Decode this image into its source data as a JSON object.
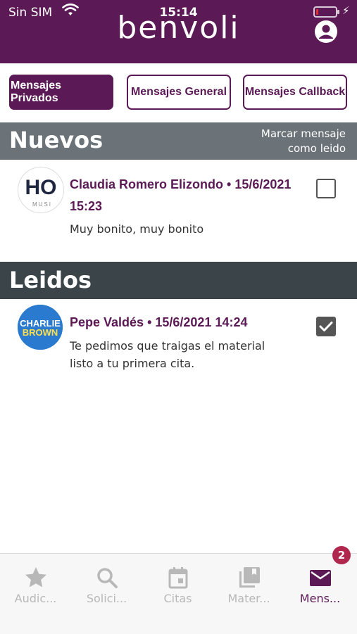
{
  "status_bar": {
    "carrier": "Sin SIM",
    "time": "15:14"
  },
  "header": {
    "logo": "benvoli"
  },
  "tabs": [
    {
      "label": "Mensajes Privados",
      "active": true
    },
    {
      "label": "Mensajes General",
      "active": false
    },
    {
      "label": "Mensajes Callback",
      "active": false
    }
  ],
  "nuevos": {
    "title": "Nuevos",
    "mark_label_line1": "Marcar mensaje",
    "mark_label_line2": "como leido",
    "messages": [
      {
        "sender_line1": "Claudia Romero Elizondo • 15/6/2021",
        "sender_line2": "15:23",
        "body": "Muy bonito, muy bonito",
        "avatar_text": "HO",
        "avatar_sub": "MUSI",
        "read": false
      }
    ]
  },
  "leidos": {
    "title": "Leidos",
    "messages": [
      {
        "sender_line1": "Pepe  Valdés • 15/6/2021 14:24",
        "body_line1": "Te pedimos que traigas el material",
        "body_line2": "listo a tu primera cita.",
        "avatar_text1": "CHARLIE",
        "avatar_text2": "BROWN",
        "read": true
      }
    ]
  },
  "navbar": {
    "items": [
      {
        "label": "Audic...",
        "icon": "star-icon"
      },
      {
        "label": "Solici...",
        "icon": "search-icon"
      },
      {
        "label": "Citas",
        "icon": "calendar-icon"
      },
      {
        "label": "Mater...",
        "icon": "library-icon"
      },
      {
        "label": "Mens...",
        "icon": "mail-icon",
        "active": true
      }
    ],
    "badge": "2"
  },
  "colors": {
    "brand": "#5b1a55",
    "nuevos_bar": "#6b7378",
    "leidos_bar": "#3b4449",
    "badge": "#b0284e"
  }
}
